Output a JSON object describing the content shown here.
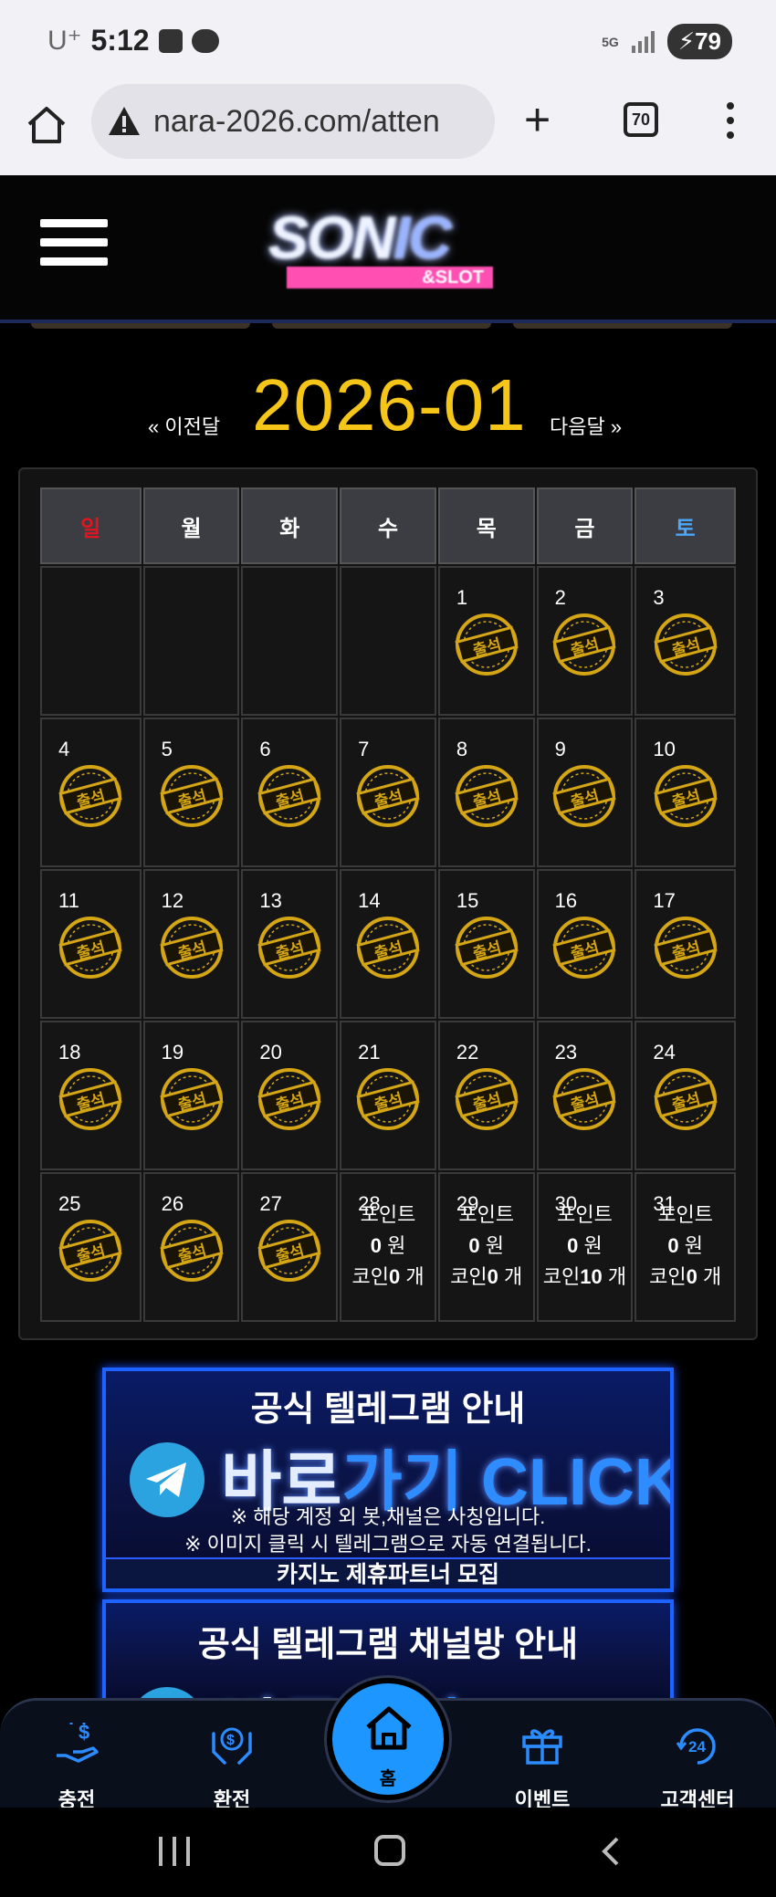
{
  "status_bar": {
    "carrier": "U⁺",
    "time": "5:12",
    "network": "5G",
    "battery": "79"
  },
  "browser": {
    "url": "nara-2026.com/atten",
    "tab_count": "70"
  },
  "site": {
    "logo_text": "SONIC",
    "logo_sub": "&SLOT"
  },
  "calendar": {
    "prev_label": "« 이전달",
    "month": "2026-01",
    "next_label": "다음달 »",
    "weekdays": [
      "일",
      "월",
      "화",
      "수",
      "목",
      "금",
      "토"
    ],
    "stamp_text": "출석",
    "days": [
      "1",
      "2",
      "3",
      "4",
      "5",
      "6",
      "7",
      "8",
      "9",
      "10",
      "11",
      "12",
      "13",
      "14",
      "15",
      "16",
      "17",
      "18",
      "19",
      "20",
      "21",
      "22",
      "23",
      "24",
      "25",
      "26",
      "27",
      "28",
      "29",
      "30",
      "31"
    ],
    "attended_through": 27,
    "future": [
      {
        "day": "28",
        "point_label": "포인트",
        "won": "0",
        "won_unit": "원",
        "coin_label": "코인",
        "coin": "0",
        "coin_unit": "개"
      },
      {
        "day": "29",
        "point_label": "포인트",
        "won": "0",
        "won_unit": "원",
        "coin_label": "코인",
        "coin": "0",
        "coin_unit": "개"
      },
      {
        "day": "30",
        "point_label": "포인트",
        "won": "0",
        "won_unit": "원",
        "coin_label": "코인",
        "coin": "10",
        "coin_unit": "개"
      },
      {
        "day": "31",
        "point_label": "포인트",
        "won": "0",
        "won_unit": "원",
        "coin_label": "코인",
        "coin": "0",
        "coin_unit": "개"
      }
    ]
  },
  "banners": [
    {
      "title": "공식 텔레그램 안내",
      "cta_white": "바로",
      "cta_blue": "가기 CLICK",
      "note1": "※ 해당 계정 외 봇,채널은 사칭입니다.",
      "note2": "※ 이미지 클릭 시 텔레그램으로 자동 연결됩니다.",
      "partner": "카지노 제휴파트너 모집"
    },
    {
      "title": "공식 텔레그램 채널방 안내",
      "cta_white": "바로",
      "cta_blue": "가기 CLICK"
    }
  ],
  "bottom_nav": {
    "charge": "충전",
    "exchange": "환전",
    "home": "홈",
    "event": "이벤트",
    "support": "고객센터"
  },
  "colors": {
    "month_title": "#f5c518",
    "sunday": "#e0151f",
    "saturday": "#4aa8ff",
    "accent_blue": "#1d97ff",
    "stamp_gold": "#d4a514"
  }
}
